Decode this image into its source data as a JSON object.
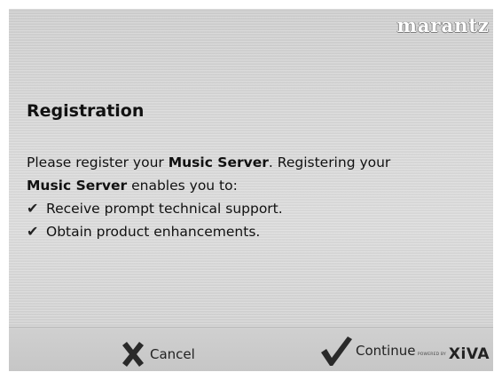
{
  "brand": {
    "logo": "marantz"
  },
  "dialog": {
    "title": "Registration",
    "intro_1": "Please register your ",
    "intro_bold_1": "Music Server",
    "intro_2": ". Registering your",
    "intro_bold_2": "Music Server",
    "intro_3": " enables you to:",
    "benefits": [
      "Receive prompt technical support.",
      "Obtain product enhancements."
    ],
    "check_glyph": "✔"
  },
  "footer": {
    "cancel_label": "Cancel",
    "continue_label": "Continue",
    "powered_by": "POWERED BY",
    "xiva_logo": "XiVA"
  },
  "icons": {
    "cancel": "x-icon",
    "continue": "checkmark-icon",
    "bullet": "checkmark-icon"
  }
}
